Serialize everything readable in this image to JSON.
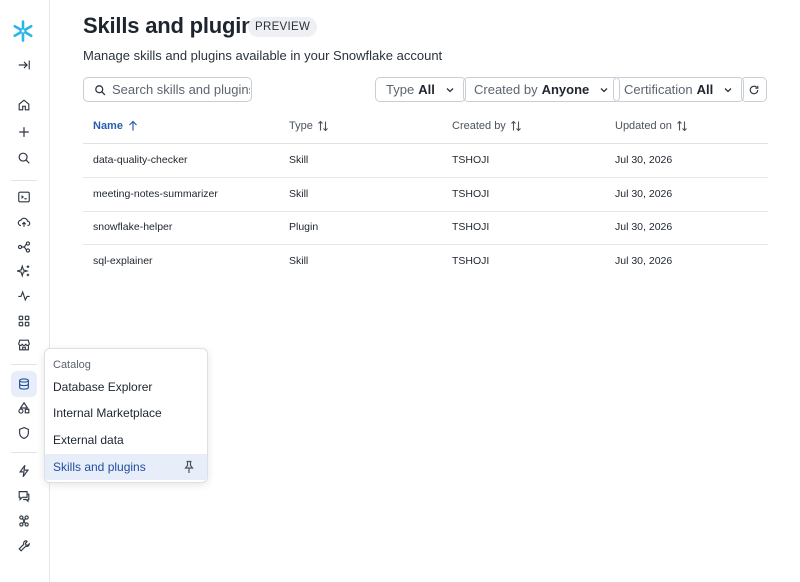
{
  "page": {
    "title": "Skills and plugins",
    "badge": "PREVIEW",
    "subtitle": "Manage skills and plugins available in your Snowflake account"
  },
  "search": {
    "placeholder": "Search skills and plugins",
    "value": ""
  },
  "filters": [
    {
      "label": "Type",
      "value": "All"
    },
    {
      "label": "Created by",
      "value": "Anyone"
    },
    {
      "label": "Certification",
      "value": "All"
    }
  ],
  "table": {
    "columns": [
      "Name",
      "Type",
      "Created by",
      "Updated on"
    ],
    "rows": [
      [
        "data-quality-checker",
        "Skill",
        "TSHOJI",
        "Jul 30, 2026"
      ],
      [
        "meeting-notes-summarizer",
        "Skill",
        "TSHOJI",
        "Jul 30, 2026"
      ],
      [
        "snowflake-helper",
        "Plugin",
        "TSHOJI",
        "Jul 30, 2026"
      ],
      [
        "sql-explainer",
        "Skill",
        "TSHOJI",
        "Jul 30, 2026"
      ]
    ]
  },
  "catalog_menu": {
    "header": "Catalog",
    "items": [
      "Database Explorer",
      "Internal Marketplace",
      "External data",
      "Skills and plugins"
    ],
    "selected": "Skills and plugins"
  },
  "sidebar": {
    "icons": [
      "snowflake-logo-icon",
      "expand-sidebar-icon",
      "home-icon",
      "plus-icon",
      "search-icon",
      "terminal-icon",
      "cloud-upload-icon",
      "data-flow-icon",
      "ai-sparkle-icon",
      "activity-icon",
      "apps-grid-icon",
      "marketplace-icon",
      "database-icon",
      "shapes-icon",
      "shield-icon",
      "lightning-icon",
      "chat-icon",
      "admin-nodes-icon",
      "tools-icon"
    ]
  },
  "colors": {
    "accent": "#2a5db0",
    "selected_bg": "#e8eef9",
    "logo": "#29b5e8"
  }
}
